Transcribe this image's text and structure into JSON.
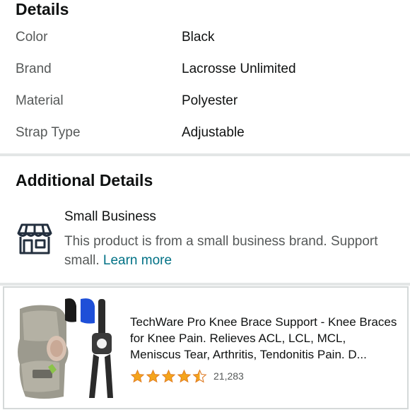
{
  "details": {
    "title": "Details",
    "rows": [
      {
        "key": "Color",
        "value": "Black"
      },
      {
        "key": "Brand",
        "value": "Lacrosse Unlimited"
      },
      {
        "key": "Material",
        "value": "Polyester"
      },
      {
        "key": "Strap Type",
        "value": "Adjustable"
      }
    ]
  },
  "additional": {
    "title": "Additional Details",
    "small_business": {
      "icon": "storefront-icon",
      "title": "Small Business",
      "description": "This product is from a small business brand. Support small.",
      "link": "Learn more"
    }
  },
  "product": {
    "image": "knee-brace-product-image",
    "title": "TechWare Pro Knee Brace Support - Knee Braces for Knee Pain. Relieves ACL, LCL, MCL, Meniscus Tear, Arthritis, Tendonitis Pain. D...",
    "rating": 4.5,
    "rating_count": "21,283"
  },
  "colors": {
    "star": "#f4a41c",
    "link": "#007185",
    "divider": "#e3e6e6"
  }
}
